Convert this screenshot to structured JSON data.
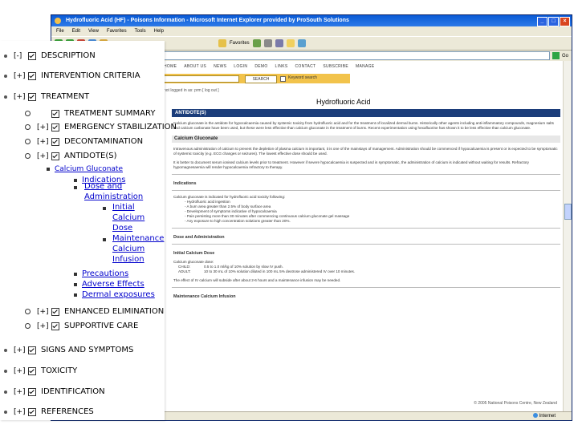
{
  "browser": {
    "title": "Hydrofluoric Acid (HF) - Poisons Information - Microsoft Internet Explorer provided by ProSouth Solutions",
    "menu": [
      "File",
      "Edit",
      "View",
      "Favorites",
      "Tools",
      "Help"
    ],
    "toolbar": {
      "favorites": "Favorites"
    },
    "go_label": "Go",
    "status_zone": "Internet"
  },
  "site": {
    "nav": [
      "HOME",
      "ABOUT US",
      "NEWS",
      "LOGIN",
      "DEMO",
      "LINKS",
      "CONTACT",
      "SUBSCRIBE",
      "MANAGE"
    ],
    "search_button": "SEARCH",
    "keyword_label": "Keyword search",
    "login_text": "not logged in as: prm [ log out ]",
    "page_title": "Hydrofluoric Acid"
  },
  "article": {
    "section": "ANTIDOTE(S)",
    "intro": "Calcium gluconate is the antidote for hypocalcaemia caused by systemic toxicity from hydrofluoric acid and for the treatment of localized dermal burns. Historically other agents including anti-inflammatory compounds, magnesium salts and calcium carbonate have been used, but these were less effective than calcium gluconate in the treatment of burns. Recent experimentation using hexafluorine has shown it to be less effective than calcium gluconate.",
    "subheading": "Calcium Gluconate",
    "p1": "Intravenous administration of calcium to prevent the depletion of plasma calcium is important, it is one of the mainstays of management. Administration should be commenced if hypocalcaemia is present or is expected to be symptomatic of systemic toxicity (e.g. ECG changes or seizures). The lowest effective dose should be used.",
    "p2": "It is better to document serum ionised calcium levels prior to treatment. However if severe hypocalcaemia is suspected and is symptomatic, the administration of calcium is indicated without waiting for results. Refractory hypomagnesaemia will render hypocalcaemia refractory to therapy.",
    "indications_heading": "Indications",
    "indications_intro": "Calcium gluconate is indicated for hydrofluoric acid toxicity following:",
    "indications": [
      "- Hydrofluoric acid ingestion",
      "- A burn area greater than 2.5% of body surface area",
      "- Development of symptoms indicative of hypocalcaemia",
      "- Pain persisting more than 30 minutes after commencing continuous calcium gluconate gel massage",
      "- Any exposure to high concentration solutions greater than 20%."
    ],
    "dose_heading": "Dose and Administration",
    "initial_dose_heading": "Initial Calcium Dose",
    "dose_intro": "Calcium gluconate dose:",
    "child_label": "CHILD:",
    "child_dose": "0.5 to 1.0 ml/kg of 10% solution by slow IV push.",
    "adult_label": "ADULT:",
    "adult_dose": "10 to 30 mL of 10% solution diluted in 100 mL 5% dextrose administered IV over 10 minutes.",
    "effect_note": "The effect of IV calcium will subside after about 2-6 hours and a maintenance infusion may be needed.",
    "maintenance_heading": "Maintenance Calcium Infusion",
    "footer": "© 2005 National Poisons Centre, New Zealand"
  },
  "outline": {
    "items": [
      {
        "toggle": "[-]",
        "label": "DESCRIPTION"
      },
      {
        "toggle": "[+]",
        "label": "INTERVENTION CRITERIA"
      },
      {
        "toggle": "[+]",
        "label": "TREATMENT"
      },
      {
        "label": "TREATMENT SUMMARY"
      },
      {
        "toggle": "[+]",
        "label": "EMERGENCY STABILIZATION"
      },
      {
        "toggle": "[+]",
        "label": "DECONTAMINATION"
      },
      {
        "toggle": "[+]",
        "label": "ANTIDOTE(S)"
      },
      {
        "label": "Calcium Gluconate"
      },
      {
        "label": "Indications"
      },
      {
        "label": "Dose and Administration"
      },
      {
        "label": "Initial Calcium Dose"
      },
      {
        "label": "Maintenance Calcium Infusion"
      },
      {
        "label": "Precautions"
      },
      {
        "label": "Adverse Effects"
      },
      {
        "label": "Dermal exposures"
      },
      {
        "toggle": "[+]",
        "label": "ENHANCED ELIMINATION"
      },
      {
        "toggle": "[+]",
        "label": "SUPPORTIVE CARE"
      },
      {
        "toggle": "[+]",
        "label": "SIGNS AND SYMPTOMS"
      },
      {
        "toggle": "[+]",
        "label": "TOXICITY"
      },
      {
        "toggle": "[+]",
        "label": "IDENTIFICATION"
      },
      {
        "toggle": "[+]",
        "label": "REFERENCES"
      }
    ]
  }
}
